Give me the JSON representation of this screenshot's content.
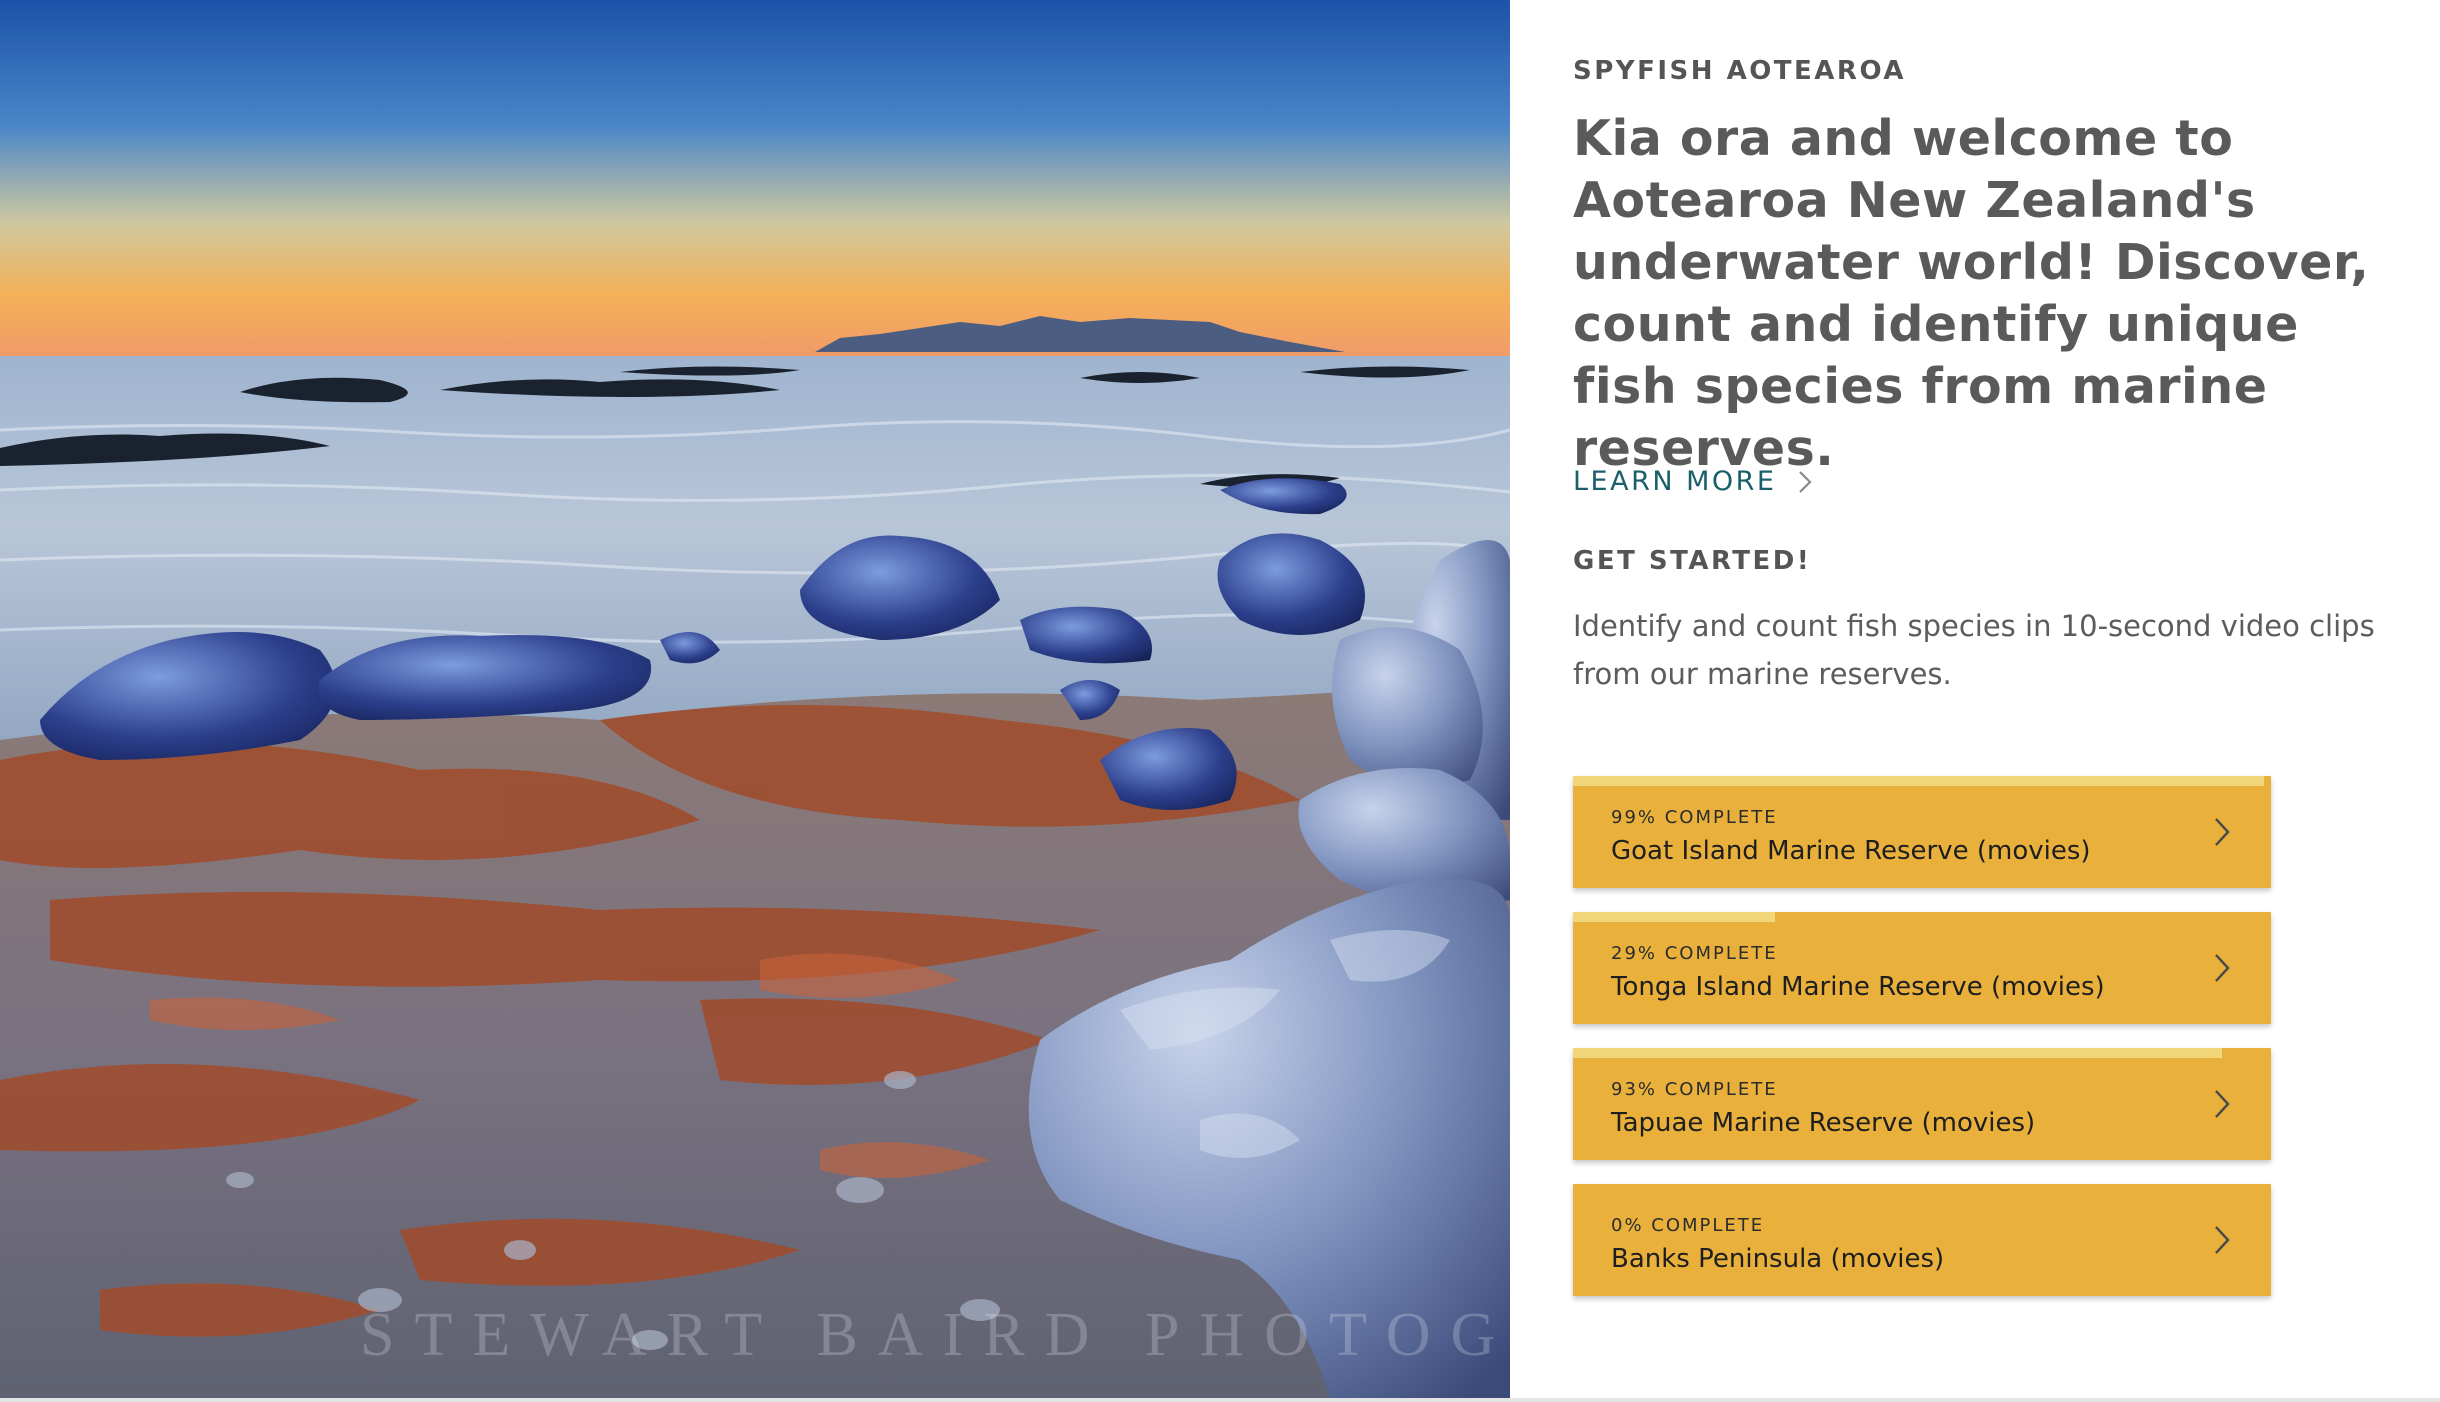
{
  "hero": {
    "watermark": "STEWART BAIRD PHOTOGRAPHY"
  },
  "header": {
    "eyebrow": "SPYFISH AOTEAROA",
    "headline": "Kia ora and welcome to Aotearoa New Zealand's underwater world! Discover, count and identify unique fish species from marine reserves.",
    "learn_more": "LEARN MORE",
    "learn_more_icon": "chevron-right-icon"
  },
  "get_started": {
    "title": "GET STARTED!",
    "description": "Identify and count fish species in 10-second video clips from our marine reserves."
  },
  "colors": {
    "card_background": "#e9b13c",
    "card_progress": "#f2d67a",
    "link": "#1b5f6a"
  },
  "projects": [
    {
      "progress_label": "99% COMPLETE",
      "progress": 0.99,
      "name": "Goat Island Marine Reserve (movies)",
      "icon": "chevron-right-icon"
    },
    {
      "progress_label": "29% COMPLETE",
      "progress": 0.29,
      "name": "Tonga Island Marine Reserve (movies)",
      "icon": "chevron-right-icon"
    },
    {
      "progress_label": "93% COMPLETE",
      "progress": 0.93,
      "name": "Tapuae Marine Reserve (movies)",
      "icon": "chevron-right-icon"
    },
    {
      "progress_label": "0% COMPLETE",
      "progress": 0.0,
      "name": "Banks Peninsula (movies)",
      "icon": "chevron-right-icon"
    }
  ]
}
